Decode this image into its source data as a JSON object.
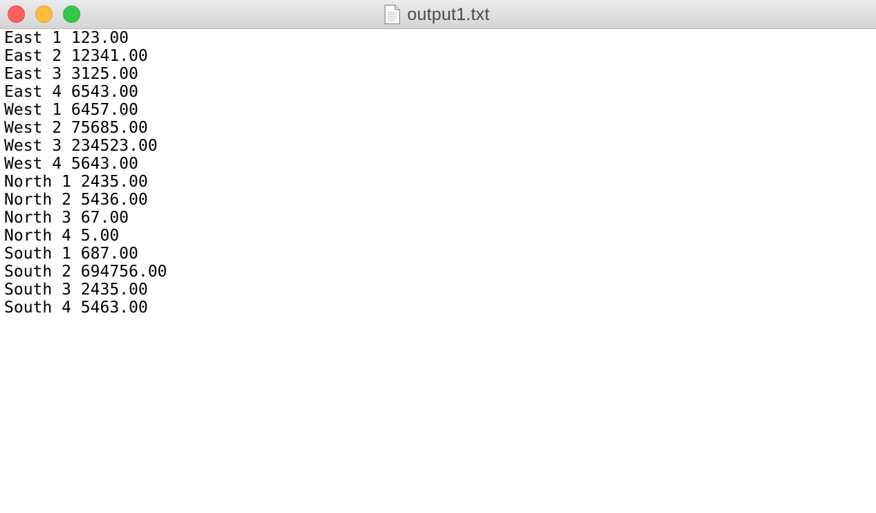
{
  "window": {
    "title": "output1.txt",
    "title_icon": "document-icon",
    "buttons": {
      "close_color": "#fc605c",
      "minimize_color": "#fdbc40",
      "zoom_color": "#34c84a"
    }
  },
  "document": {
    "lines": [
      "East 1 123.00",
      "East 2 12341.00",
      "East 3 3125.00",
      "East 4 6543.00",
      "West 1 6457.00",
      "West 2 75685.00",
      "West 3 234523.00",
      "West 4 5643.00",
      "North 1 2435.00",
      "North 2 5436.00",
      "North 3 67.00",
      "North 4 5.00",
      "South 1 687.00",
      "South 2 694756.00",
      "South 3 2435.00",
      "South 4 5463.00"
    ]
  }
}
